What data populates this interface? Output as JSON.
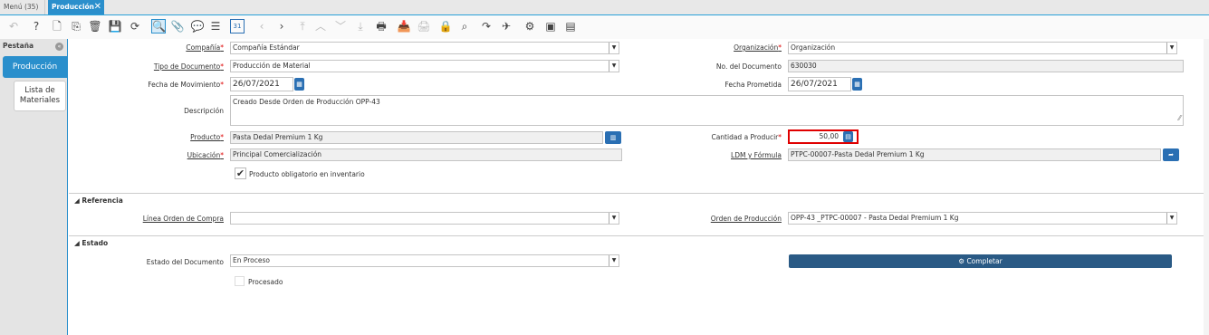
{
  "tabs": {
    "menu": "Menú (35)",
    "active": "Producción",
    "close": "✕"
  },
  "toolbar": {
    "icons": [
      "undo-icon",
      "help-icon",
      "new-icon",
      "copy-icon",
      "delete-icon",
      "save-icon",
      "refresh-icon",
      "find-icon",
      "attachment-icon",
      "chat-icon",
      "grid-toggle-icon",
      "calendar-icon",
      "prev-icon",
      "next-icon",
      "first-icon",
      "up-icon",
      "down-icon",
      "last-icon",
      "report-icon",
      "archive-icon",
      "print-icon",
      "lock-icon",
      "zoom-icon",
      "workflow-icon",
      "send-icon",
      "process-icon",
      "export-icon",
      "post-icon"
    ],
    "glyphs": [
      "↶",
      "?",
      "🗋",
      "⎘",
      "🗑",
      "💾",
      "⟳",
      "🔍",
      "📎",
      "💬",
      "☰",
      "31",
      "‹",
      "›",
      "⤒",
      "︿",
      "﹀",
      "⤓",
      "🖶",
      "📥",
      "🖨",
      "🔒",
      "⌕",
      "↷",
      "✈",
      "⚙",
      "▣",
      "▤"
    ]
  },
  "side": {
    "title": "Pestaña",
    "toggle": "«",
    "tabs": [
      "Producción",
      "Lista de Materiales"
    ]
  },
  "form": {
    "company": {
      "label": "Compañía",
      "value": "Compañía Estándar"
    },
    "org": {
      "label": "Organización",
      "value": "Organización"
    },
    "doctype": {
      "label": "Tipo de Documento",
      "value": "Producción de Material"
    },
    "docno": {
      "label": "No. del Documento",
      "value": "630030"
    },
    "movdate": {
      "label": "Fecha de Movimiento",
      "value": "26/07/2021"
    },
    "promdate": {
      "label": "Fecha Prometida",
      "value": "26/07/2021"
    },
    "desc": {
      "label": "Descripción",
      "value": "Creado Desde Orden de Producción OPP-43"
    },
    "product": {
      "label": "Producto",
      "value": "Pasta Dedal Premium 1 Kg"
    },
    "qty": {
      "label": "Cantidad a Producir",
      "value": "50,00"
    },
    "location": {
      "label": "Ubicación",
      "value": "Principal Comercialización"
    },
    "bom": {
      "label": "LDM y Fórmula",
      "value": "PTPC-00007-Pasta Dedal Premium 1 Kg"
    },
    "mandatory": {
      "label": "Producto obligatorio en inventario"
    }
  },
  "ref": {
    "title": "Referencia",
    "poline": {
      "label": "Línea Orden de Compra",
      "value": ""
    },
    "prodorder": {
      "label": "Orden de Producción",
      "value": "OPP-43 _PTPC-00007 - Pasta Dedal Premium 1 Kg"
    }
  },
  "state": {
    "title": "Estado",
    "docstatus": {
      "label": "Estado del Documento",
      "value": "En Proceso"
    },
    "processed": {
      "label": "Procesado"
    },
    "complete": "Completar"
  },
  "colors": {
    "accent": "#2a8fcc",
    "button": "#2a5a85",
    "highlight": "#e00000"
  }
}
